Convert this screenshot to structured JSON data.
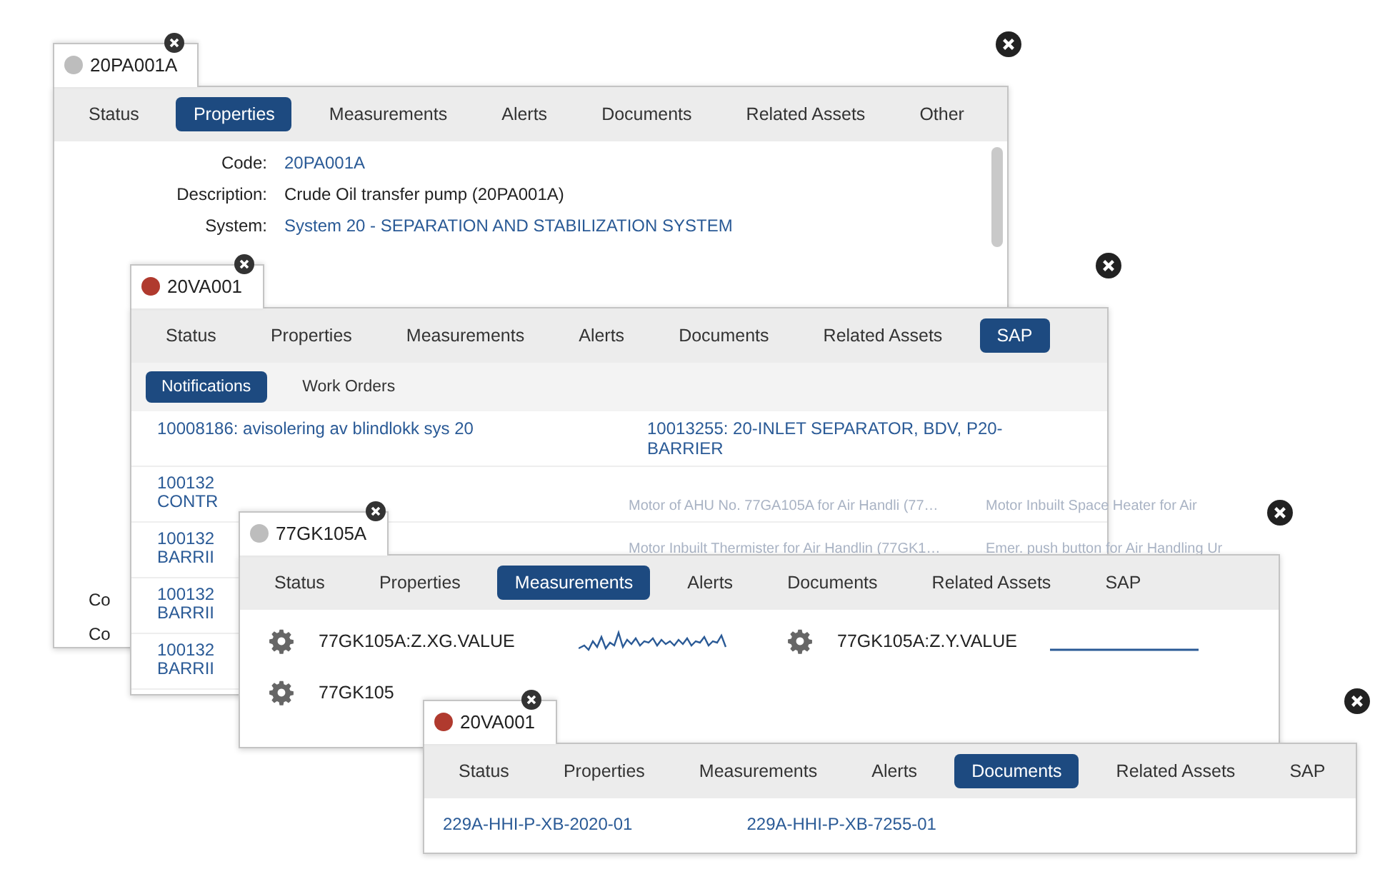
{
  "windows": [
    {
      "title": "20PA001A",
      "color": "#bdbdbd",
      "kind": "properties",
      "tabs": [
        {
          "label": "Status",
          "selected": false
        },
        {
          "label": "Properties",
          "selected": true
        },
        {
          "label": "Measurements",
          "selected": false
        },
        {
          "label": "Alerts",
          "selected": false
        },
        {
          "label": "Documents",
          "selected": false
        },
        {
          "label": "Related Assets",
          "selected": false
        },
        {
          "label": "Other",
          "selected": false
        }
      ],
      "properties": [
        {
          "label": "Code:",
          "value": "20PA001A",
          "link": true
        },
        {
          "label": "Description:",
          "value": "Crude Oil transfer pump (20PA001A)",
          "link": false
        },
        {
          "label": "System:",
          "value": "System 20 - SEPARATION AND STABILIZATION SYSTEM",
          "link": true
        }
      ],
      "fragments": [
        "Co",
        "Co"
      ]
    },
    {
      "title": "20VA001",
      "color": "#b03a2e",
      "kind": "sap",
      "tabs": [
        {
          "label": "Status",
          "selected": false
        },
        {
          "label": "Properties",
          "selected": false
        },
        {
          "label": "Measurements",
          "selected": false
        },
        {
          "label": "Alerts",
          "selected": false
        },
        {
          "label": "Documents",
          "selected": false
        },
        {
          "label": "Related Assets",
          "selected": false
        },
        {
          "label": "SAP",
          "selected": true
        }
      ],
      "subtabs": [
        {
          "label": "Notifications",
          "selected": true
        },
        {
          "label": "Work Orders",
          "selected": false
        }
      ],
      "notifications": [
        [
          "10008186: avisolering av blindlokk sys 20",
          "10013255: 20-INLET SEPARATOR, BDV, P20-BARRIER"
        ],
        [
          "100132 CONTR"
        ],
        [
          "100132 BARRII"
        ],
        [
          "100132 BARRII"
        ],
        [
          "100132 BARRII"
        ]
      ]
    },
    {
      "kind": "ghost",
      "items": [
        "Motor of AHU No. 77GA105A for Air Handli (77…",
        "Motor Inbuilt Space Heater for Air",
        "Motor Inbuilt Thermister for Air Handlin (77GK1…",
        "Emer. push button for Air Handling Ur"
      ]
    },
    {
      "title": "77GK105A",
      "color": "#bdbdbd",
      "kind": "measurements",
      "tabs": [
        {
          "label": "Status",
          "selected": false
        },
        {
          "label": "Properties",
          "selected": false
        },
        {
          "label": "Measurements",
          "selected": true
        },
        {
          "label": "Alerts",
          "selected": false
        },
        {
          "label": "Documents",
          "selected": false
        },
        {
          "label": "Related Assets",
          "selected": false
        },
        {
          "label": "SAP",
          "selected": false
        }
      ],
      "measurements": [
        {
          "name": "77GK105A:Z.XG.VALUE",
          "kind": "wave"
        },
        {
          "name": "77GK105A:Z.Y.VALUE",
          "kind": "flat"
        },
        {
          "name": "77GK105",
          "kind": "none"
        }
      ]
    },
    {
      "title": "20VA001",
      "color": "#b03a2e",
      "kind": "documents",
      "tabs": [
        {
          "label": "Status",
          "selected": false
        },
        {
          "label": "Properties",
          "selected": false
        },
        {
          "label": "Measurements",
          "selected": false
        },
        {
          "label": "Alerts",
          "selected": false
        },
        {
          "label": "Documents",
          "selected": true
        },
        {
          "label": "Related Assets",
          "selected": false
        },
        {
          "label": "SAP",
          "selected": false
        }
      ],
      "documents": [
        "229A-HHI-P-XB-2020-01",
        "229A-HHI-P-XB-7255-01"
      ]
    }
  ]
}
